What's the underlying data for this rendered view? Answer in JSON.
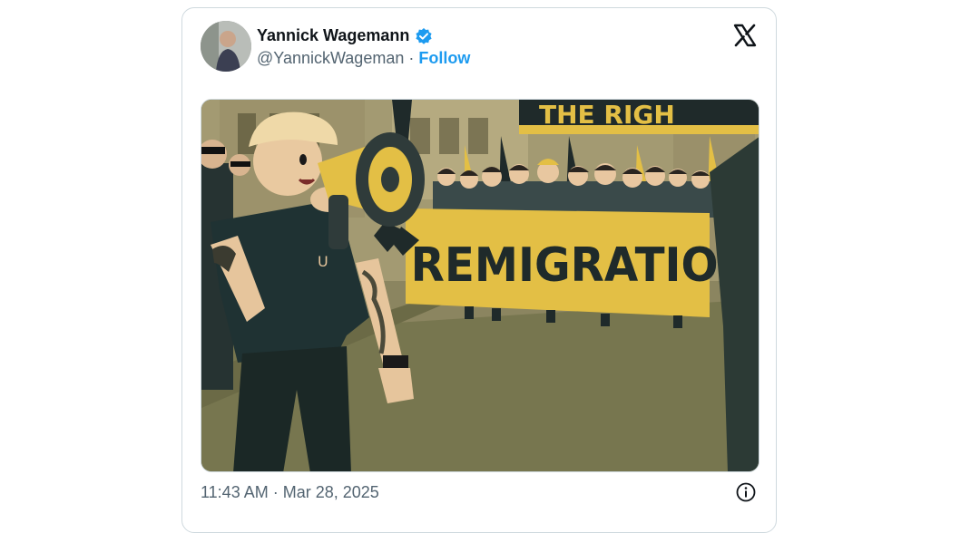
{
  "tweet": {
    "author_name": "Yannick Wagemann",
    "handle": "@YannickWageman",
    "separator": "·",
    "follow_label": "Follow",
    "timestamp": "11:43 AM · Mar 28, 2025",
    "verified": true
  },
  "media": {
    "banner_text": "REMIGRATION",
    "top_banner_text": "THE RIGH"
  },
  "icons": {
    "verified": "verified-badge-icon",
    "brand": "x-logo-icon",
    "info": "info-icon"
  },
  "colors": {
    "link": "#1d9bf0",
    "verified": "#1d9bf0",
    "text_primary": "#0f1419",
    "text_secondary": "#536471",
    "banner_yellow": "#e3bf45"
  }
}
